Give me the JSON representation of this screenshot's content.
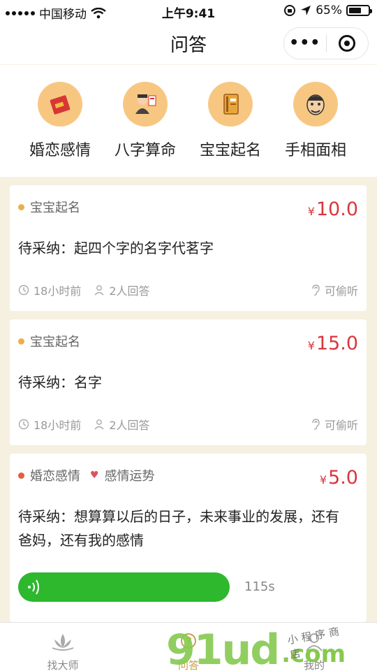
{
  "status_bar": {
    "carrier": "中国移动",
    "time": "上午9:41",
    "battery": "65%",
    "battery_level": 0.65
  },
  "nav": {
    "title": "问答",
    "more_icon": "more-dots-icon",
    "close_icon": "close-target-icon"
  },
  "categories": [
    {
      "label": "婚恋感情",
      "icon": "red-envelope-icon"
    },
    {
      "label": "八字算命",
      "icon": "fortune-teller-icon"
    },
    {
      "label": "宝宝起名",
      "icon": "book-icon"
    },
    {
      "label": "手相面相",
      "icon": "face-icon"
    }
  ],
  "cards": [
    {
      "tags": [
        {
          "label": "宝宝起名",
          "icon": "book-tag-icon",
          "color": "#e8b24a"
        }
      ],
      "currency": "¥",
      "price": "10.0",
      "question": "待采纳：起四个字的名字代茗字",
      "time_ago": "18小时前",
      "answers": "2人回答",
      "listen": "可偷听"
    },
    {
      "tags": [
        {
          "label": "宝宝起名",
          "icon": "book-tag-icon",
          "color": "#e8b24a"
        }
      ],
      "currency": "¥",
      "price": "15.0",
      "question": "待采纳：名字",
      "time_ago": "18小时前",
      "answers": "2人回答",
      "listen": "可偷听"
    },
    {
      "tags": [
        {
          "label": "婚恋感情",
          "icon": "love-tag-icon",
          "color": "#e0603a"
        },
        {
          "label": "感情运势",
          "icon": "heart-tag-icon",
          "color": "#e0505a"
        }
      ],
      "currency": "¥",
      "price": "5.0",
      "question": "待采纳：想算算以后的日子，未来事业的发展，还有爸妈，还有我的感情",
      "voice_duration": "115s",
      "voice_color": "#2db82d"
    }
  ],
  "tab_bar": {
    "tabs": [
      {
        "label": "找大师",
        "icon": "lotus-icon",
        "active": false
      },
      {
        "label": "问答",
        "icon": "qa-icon",
        "active": true
      },
      {
        "label": "我的",
        "icon": "user-icon",
        "active": false
      }
    ]
  },
  "watermark": {
    "text": "91ud",
    "suffix": ".com",
    "sub": "小程序商店"
  },
  "colors": {
    "price": "#d9363e",
    "background": "#f6f0e0",
    "category_icon_bg": "#f7c782",
    "active_tab": "#c8a248"
  }
}
